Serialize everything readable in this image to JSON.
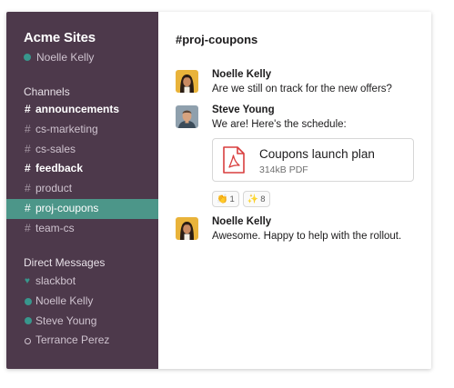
{
  "workspace": {
    "name": "Acme Sites",
    "user": "Noelle Kelly"
  },
  "sidebar": {
    "channels_heading": "Channels",
    "channels": [
      {
        "name": "announcements",
        "bold": true,
        "active": false
      },
      {
        "name": "cs-marketing",
        "bold": false,
        "active": false
      },
      {
        "name": "cs-sales",
        "bold": false,
        "active": false
      },
      {
        "name": "feedback",
        "bold": true,
        "active": false
      },
      {
        "name": "product",
        "bold": false,
        "active": false
      },
      {
        "name": "proj-coupons",
        "bold": false,
        "active": true
      },
      {
        "name": "team-cs",
        "bold": false,
        "active": false
      }
    ],
    "dm_heading": "Direct Messages",
    "direct_messages": [
      {
        "name": "slackbot",
        "status": "heart"
      },
      {
        "name": "Noelle Kelly",
        "status": "online"
      },
      {
        "name": "Steve Young",
        "status": "online"
      },
      {
        "name": "Terrance Perez",
        "status": "away"
      }
    ]
  },
  "main": {
    "channel_title": "#proj-coupons",
    "messages": [
      {
        "author": "Noelle Kelly",
        "text": "Are we still on track for the new offers?",
        "avatar": "avatar-noelle"
      },
      {
        "author": "Steve Young",
        "text": "We are! Here's the schedule:",
        "avatar": "avatar-steve",
        "attachment": {
          "name": "Coupons launch plan",
          "meta": "314kB PDF",
          "icon": "pdf-icon"
        },
        "reactions": [
          {
            "emoji": "👏",
            "count": "1"
          },
          {
            "emoji": "✨",
            "count": "8"
          }
        ]
      },
      {
        "author": "Noelle Kelly",
        "text": "Awesome. Happy to help with the rollout.",
        "avatar": "avatar-noelle"
      }
    ]
  },
  "colors": {
    "sidebar_bg": "#4d394b",
    "active_channel_bg": "#4c9689",
    "online_status": "#38978d",
    "pdf_red": "#d93f3f"
  }
}
